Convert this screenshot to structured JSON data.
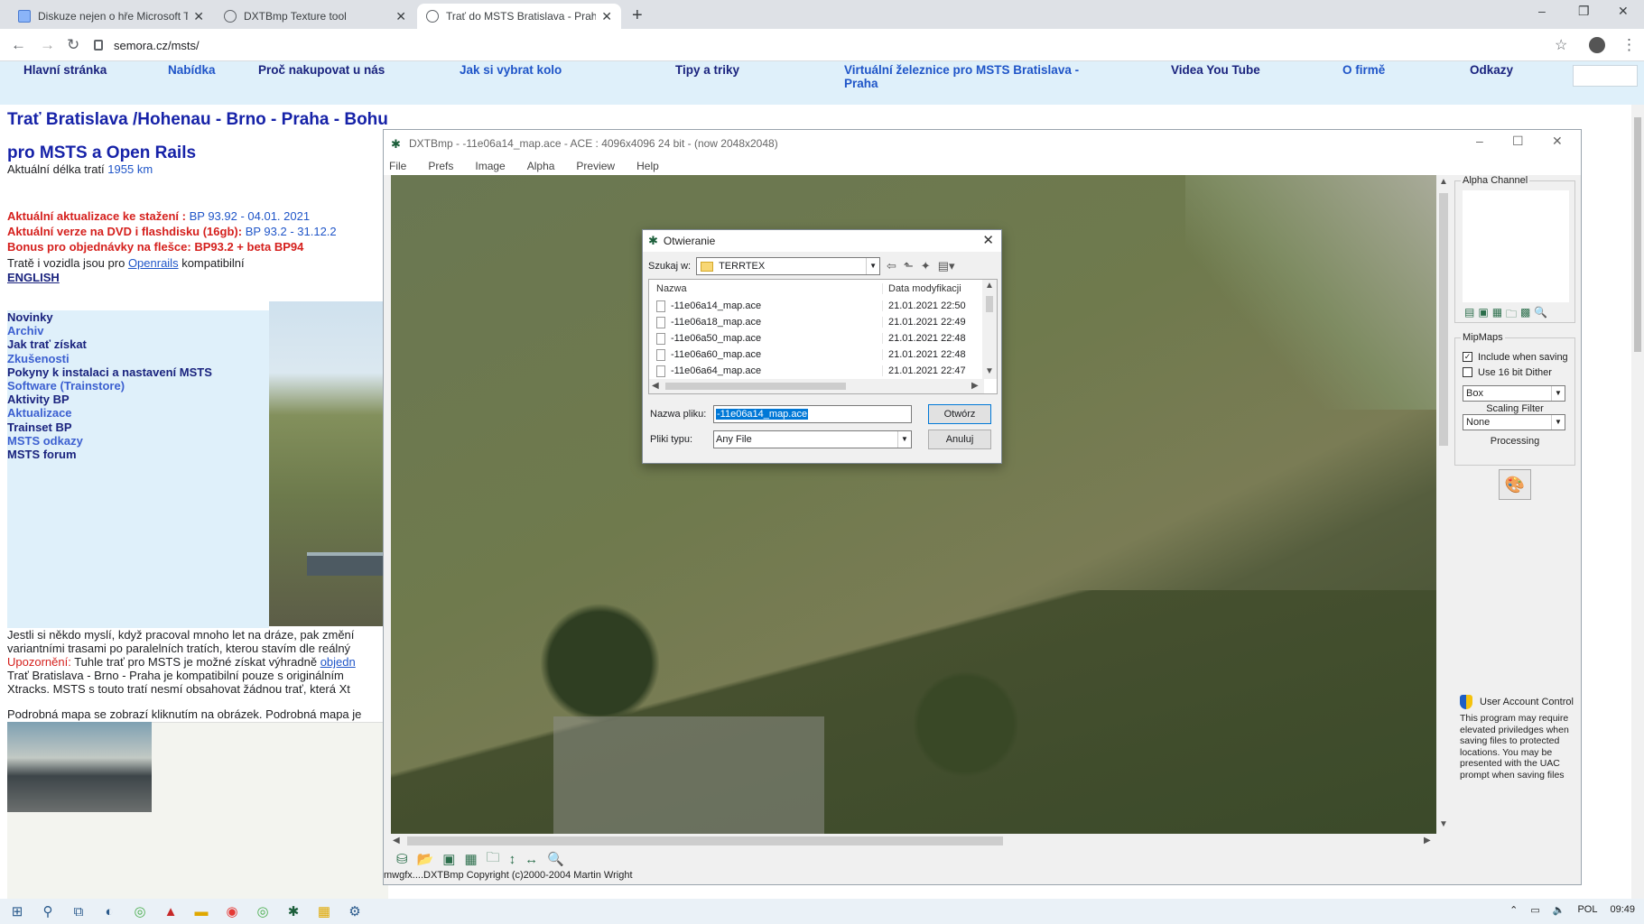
{
  "browser": {
    "tabs": [
      {
        "label": "Diskuze nejen o hře Microsoft Tr",
        "active": false
      },
      {
        "label": "DXTBmp Texture tool",
        "active": false
      },
      {
        "label": "Trať do MSTS Bratislava - Praha",
        "active": true
      }
    ],
    "url": "semora.cz/msts/"
  },
  "sitenav": {
    "items": [
      "Hlavní stránka",
      "Nabídka",
      "Proč nakupovat u nás",
      "Jak si vybrat kolo",
      "Tipy a triky",
      "Virtuální železnice pro MSTS Bratislava -",
      "Praha",
      "Videa You Tube",
      "O firmě",
      "Odkazy"
    ]
  },
  "page": {
    "title": "Trať Bratislava /Hohenau - Brno - Praha - Bohumín",
    "subtitle": "pro MSTS a Open Rails",
    "length_label": "Aktuální délka tratí",
    "length_value": "1955 km",
    "update_label": "Aktuální aktualizace ke stažení :",
    "update_value": "BP 93.92 - 04.01. 2021",
    "dvd_label": "Aktuální verze na DVD i flashdisku (16gb):",
    "dvd_value": "BP 93.2 - 31.12.2",
    "bonus": "Bonus pro objednávky na flešce: BP93.2 + beta BP94",
    "compat_pre": "Tratě i vozidla jsou pro",
    "compat_link": "Openrails",
    "compat_post": "kompatibilní",
    "english": "ENGLISH",
    "menu": [
      "Novinky",
      "Archiv",
      "Jak trať získat",
      "Zkušenosti",
      "Pokyny k instalaci a nastavení MSTS",
      "Software  (Trainstore)",
      "Aktivity BP",
      "Aktualizace",
      "Trainset BP",
      "MSTS odkazy",
      "MSTS forum"
    ],
    "para1": "Jestli si někdo myslí, když pracoval mnoho let na dráze, pak změní",
    "para2": "variantními trasami po paralelních tratích, kterou stavím dle reálný",
    "warn_label": "Upozornění:",
    "warn_text": "Tuhle trať pro MSTS je možné získat výhradně",
    "warn_link": "objedn",
    "para3": "Trať Bratislava - Brno - Praha je kompatibilní pouze s originálním",
    "para4": "Xtracks.  MSTS s touto tratí nesmí obsahovat žádnou trať, která Xt",
    "para5": "Podrobná mapa se zobrazí kliknutím na obrázek. Podrobná mapa je"
  },
  "dxt": {
    "title": "DXTBmp - -11e06a14_map.ace - ACE : 4096x4096 24 bit - (now 2048x2048)",
    "menu": [
      "File",
      "Prefs",
      "Image",
      "Alpha",
      "Preview",
      "Help"
    ],
    "alpha_label": "Alpha Channel",
    "mipmaps_label": "MipMaps",
    "include_label": "Include when saving",
    "dither_label": "Use 16 bit Dither",
    "mip_filter": "Box",
    "scaling_label": "Scaling Filter",
    "scaling_value": "None",
    "processing_label": "Processing",
    "uac_title": "User Account Control",
    "uac_text": "This program may require elevated priviledges when saving files to protected locations. You may be presented with the UAC prompt when saving files",
    "copyright": "mwgfx....DXTBmp Copyright (c)2000-2004 Martin Wright"
  },
  "dialog": {
    "title": "Otwieranie",
    "lookin_label": "Szukaj w:",
    "lookin_value": "TERRTEX",
    "col_name": "Nazwa",
    "col_date": "Data modyfikacji",
    "files": [
      {
        "name": "-11e06a14_map.ace",
        "date": "21.01.2021 22:50"
      },
      {
        "name": "-11e06a18_map.ace",
        "date": "21.01.2021 22:49"
      },
      {
        "name": "-11e06a50_map.ace",
        "date": "21.01.2021 22:48"
      },
      {
        "name": "-11e06a60_map.ace",
        "date": "21.01.2021 22:48"
      },
      {
        "name": "-11e06a64_map.ace",
        "date": "21.01.2021 22:47"
      }
    ],
    "filename_label": "Nazwa pliku:",
    "filename_value": "-11e06a14_map.ace",
    "filetype_label": "Pliki typu:",
    "filetype_value": "Any File",
    "open_button": "Otwórz",
    "cancel_button": "Anuluj"
  },
  "taskbar": {
    "lang": "POL",
    "time": "09:49"
  }
}
